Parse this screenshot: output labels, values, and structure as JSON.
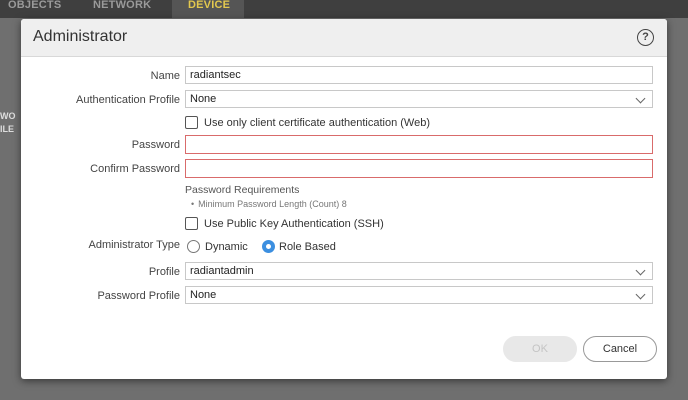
{
  "app": {
    "tabs": [
      {
        "label": "OBJECTS"
      },
      {
        "label": "NETWORK"
      },
      {
        "label": "DEVICE"
      }
    ],
    "bg_partial": [
      "WO",
      "ILE"
    ]
  },
  "dialog": {
    "title": "Administrator",
    "help_icon": "?",
    "fields": {
      "name": {
        "label": "Name",
        "value": "radiantsec"
      },
      "auth_profile": {
        "label": "Authentication Profile",
        "value": "None"
      },
      "client_cert": {
        "label": "Use only client certificate authentication (Web)",
        "checked": false
      },
      "password": {
        "label": "Password",
        "value": ""
      },
      "confirm_password": {
        "label": "Confirm Password",
        "value": ""
      },
      "password_requirements": {
        "title": "Password Requirements",
        "bullet": "•",
        "items": [
          "Minimum Password Length (Count) 8"
        ]
      },
      "public_key": {
        "label": "Use Public Key Authentication (SSH)",
        "checked": false
      },
      "admin_type": {
        "label": "Administrator Type",
        "options": [
          {
            "label": "Dynamic",
            "selected": false
          },
          {
            "label": "Role Based",
            "selected": true
          }
        ]
      },
      "profile": {
        "label": "Profile",
        "value": "radiantadmin"
      },
      "password_profile": {
        "label": "Password Profile",
        "value": "None"
      }
    },
    "buttons": {
      "ok": "OK",
      "cancel": "Cancel"
    }
  },
  "colors": {
    "error_border": "#d96b6b",
    "radio_selected": "#3c8fe0",
    "active_tab_text": "#e3c84e"
  }
}
